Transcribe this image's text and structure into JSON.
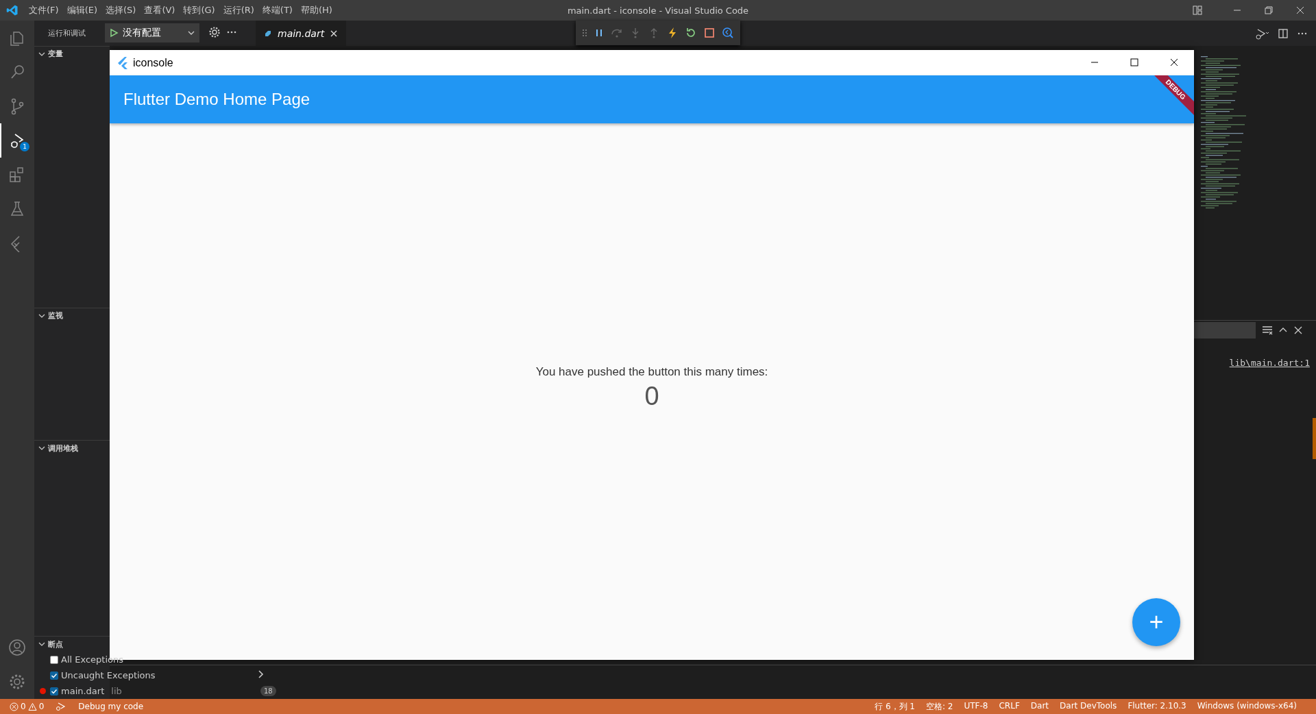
{
  "title_bar": {
    "menu": [
      "文件(F)",
      "编辑(E)",
      "选择(S)",
      "查看(V)",
      "转到(G)",
      "运行(R)",
      "终端(T)",
      "帮助(H)"
    ],
    "title": "main.dart - iconsole - Visual Studio Code"
  },
  "activity_bar": {
    "items": [
      {
        "kind": "files",
        "selected": false
      },
      {
        "kind": "search",
        "selected": false
      },
      {
        "kind": "scm",
        "selected": false
      },
      {
        "kind": "debug",
        "selected": true,
        "badge": "1"
      },
      {
        "kind": "extensions",
        "selected": false
      },
      {
        "kind": "testing",
        "selected": false
      },
      {
        "kind": "flutter",
        "selected": false
      }
    ],
    "bottom": [
      {
        "kind": "account"
      },
      {
        "kind": "settings"
      }
    ]
  },
  "sidebar": {
    "title": "运行和调试",
    "config": "没有配置",
    "sections": [
      {
        "title": "变量",
        "expanded": true
      },
      {
        "title": "监视",
        "expanded": true
      },
      {
        "title": "调用堆栈",
        "expanded": true
      },
      {
        "title": "断点",
        "expanded": true,
        "items": [
          {
            "label": "All Exceptions",
            "checked": false
          },
          {
            "label": "Uncaught Exceptions",
            "checked": true
          },
          {
            "label": "main.dart",
            "detail": "lib",
            "count": "18",
            "checked": true
          }
        ]
      }
    ]
  },
  "editor": {
    "tabs": [
      {
        "label": "main.dart",
        "selected": true
      }
    ]
  },
  "panel": {
    "link": "lib\\main.dart:1"
  },
  "app_window": {
    "title": "iconsole",
    "app_bar_title": "Flutter Demo Home Page",
    "banner": "DEBUG",
    "message": "You have pushed the button this many times:",
    "counter": "0",
    "fab": "+"
  },
  "status_bar": {
    "errors": "0",
    "warnings": "0",
    "debug_label": "Debug my code",
    "items": [
      "行 6，列 1",
      "空格: 2",
      "UTF-8",
      "CRLF",
      "Dart",
      "Dart DevTools",
      "Flutter: 2.10.3",
      "Windows (windows-x64)"
    ]
  }
}
